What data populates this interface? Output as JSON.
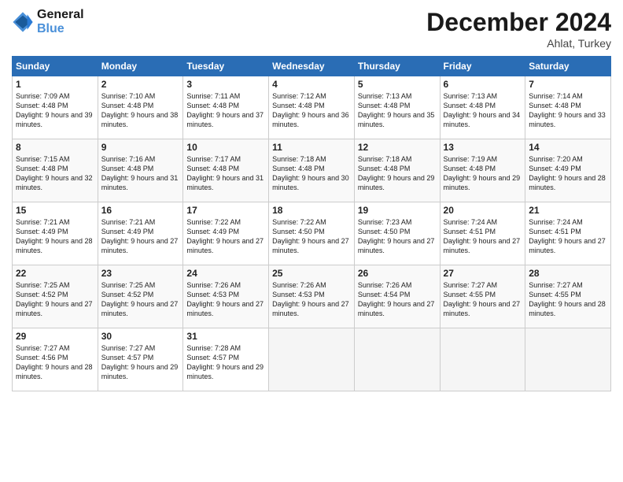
{
  "logo": {
    "line1": "General",
    "line2": "Blue"
  },
  "title": "December 2024",
  "location": "Ahlat, Turkey",
  "days_of_week": [
    "Sunday",
    "Monday",
    "Tuesday",
    "Wednesday",
    "Thursday",
    "Friday",
    "Saturday"
  ],
  "weeks": [
    [
      {
        "day": "1",
        "sunrise": "Sunrise: 7:09 AM",
        "sunset": "Sunset: 4:48 PM",
        "daylight": "Daylight: 9 hours and 39 minutes."
      },
      {
        "day": "2",
        "sunrise": "Sunrise: 7:10 AM",
        "sunset": "Sunset: 4:48 PM",
        "daylight": "Daylight: 9 hours and 38 minutes."
      },
      {
        "day": "3",
        "sunrise": "Sunrise: 7:11 AM",
        "sunset": "Sunset: 4:48 PM",
        "daylight": "Daylight: 9 hours and 37 minutes."
      },
      {
        "day": "4",
        "sunrise": "Sunrise: 7:12 AM",
        "sunset": "Sunset: 4:48 PM",
        "daylight": "Daylight: 9 hours and 36 minutes."
      },
      {
        "day": "5",
        "sunrise": "Sunrise: 7:13 AM",
        "sunset": "Sunset: 4:48 PM",
        "daylight": "Daylight: 9 hours and 35 minutes."
      },
      {
        "day": "6",
        "sunrise": "Sunrise: 7:13 AM",
        "sunset": "Sunset: 4:48 PM",
        "daylight": "Daylight: 9 hours and 34 minutes."
      },
      {
        "day": "7",
        "sunrise": "Sunrise: 7:14 AM",
        "sunset": "Sunset: 4:48 PM",
        "daylight": "Daylight: 9 hours and 33 minutes."
      }
    ],
    [
      {
        "day": "8",
        "sunrise": "Sunrise: 7:15 AM",
        "sunset": "Sunset: 4:48 PM",
        "daylight": "Daylight: 9 hours and 32 minutes."
      },
      {
        "day": "9",
        "sunrise": "Sunrise: 7:16 AM",
        "sunset": "Sunset: 4:48 PM",
        "daylight": "Daylight: 9 hours and 31 minutes."
      },
      {
        "day": "10",
        "sunrise": "Sunrise: 7:17 AM",
        "sunset": "Sunset: 4:48 PM",
        "daylight": "Daylight: 9 hours and 31 minutes."
      },
      {
        "day": "11",
        "sunrise": "Sunrise: 7:18 AM",
        "sunset": "Sunset: 4:48 PM",
        "daylight": "Daylight: 9 hours and 30 minutes."
      },
      {
        "day": "12",
        "sunrise": "Sunrise: 7:18 AM",
        "sunset": "Sunset: 4:48 PM",
        "daylight": "Daylight: 9 hours and 29 minutes."
      },
      {
        "day": "13",
        "sunrise": "Sunrise: 7:19 AM",
        "sunset": "Sunset: 4:48 PM",
        "daylight": "Daylight: 9 hours and 29 minutes."
      },
      {
        "day": "14",
        "sunrise": "Sunrise: 7:20 AM",
        "sunset": "Sunset: 4:49 PM",
        "daylight": "Daylight: 9 hours and 28 minutes."
      }
    ],
    [
      {
        "day": "15",
        "sunrise": "Sunrise: 7:21 AM",
        "sunset": "Sunset: 4:49 PM",
        "daylight": "Daylight: 9 hours and 28 minutes."
      },
      {
        "day": "16",
        "sunrise": "Sunrise: 7:21 AM",
        "sunset": "Sunset: 4:49 PM",
        "daylight": "Daylight: 9 hours and 27 minutes."
      },
      {
        "day": "17",
        "sunrise": "Sunrise: 7:22 AM",
        "sunset": "Sunset: 4:49 PM",
        "daylight": "Daylight: 9 hours and 27 minutes."
      },
      {
        "day": "18",
        "sunrise": "Sunrise: 7:22 AM",
        "sunset": "Sunset: 4:50 PM",
        "daylight": "Daylight: 9 hours and 27 minutes."
      },
      {
        "day": "19",
        "sunrise": "Sunrise: 7:23 AM",
        "sunset": "Sunset: 4:50 PM",
        "daylight": "Daylight: 9 hours and 27 minutes."
      },
      {
        "day": "20",
        "sunrise": "Sunrise: 7:24 AM",
        "sunset": "Sunset: 4:51 PM",
        "daylight": "Daylight: 9 hours and 27 minutes."
      },
      {
        "day": "21",
        "sunrise": "Sunrise: 7:24 AM",
        "sunset": "Sunset: 4:51 PM",
        "daylight": "Daylight: 9 hours and 27 minutes."
      }
    ],
    [
      {
        "day": "22",
        "sunrise": "Sunrise: 7:25 AM",
        "sunset": "Sunset: 4:52 PM",
        "daylight": "Daylight: 9 hours and 27 minutes."
      },
      {
        "day": "23",
        "sunrise": "Sunrise: 7:25 AM",
        "sunset": "Sunset: 4:52 PM",
        "daylight": "Daylight: 9 hours and 27 minutes."
      },
      {
        "day": "24",
        "sunrise": "Sunrise: 7:26 AM",
        "sunset": "Sunset: 4:53 PM",
        "daylight": "Daylight: 9 hours and 27 minutes."
      },
      {
        "day": "25",
        "sunrise": "Sunrise: 7:26 AM",
        "sunset": "Sunset: 4:53 PM",
        "daylight": "Daylight: 9 hours and 27 minutes."
      },
      {
        "day": "26",
        "sunrise": "Sunrise: 7:26 AM",
        "sunset": "Sunset: 4:54 PM",
        "daylight": "Daylight: 9 hours and 27 minutes."
      },
      {
        "day": "27",
        "sunrise": "Sunrise: 7:27 AM",
        "sunset": "Sunset: 4:55 PM",
        "daylight": "Daylight: 9 hours and 27 minutes."
      },
      {
        "day": "28",
        "sunrise": "Sunrise: 7:27 AM",
        "sunset": "Sunset: 4:55 PM",
        "daylight": "Daylight: 9 hours and 28 minutes."
      }
    ],
    [
      {
        "day": "29",
        "sunrise": "Sunrise: 7:27 AM",
        "sunset": "Sunset: 4:56 PM",
        "daylight": "Daylight: 9 hours and 28 minutes."
      },
      {
        "day": "30",
        "sunrise": "Sunrise: 7:27 AM",
        "sunset": "Sunset: 4:57 PM",
        "daylight": "Daylight: 9 hours and 29 minutes."
      },
      {
        "day": "31",
        "sunrise": "Sunrise: 7:28 AM",
        "sunset": "Sunset: 4:57 PM",
        "daylight": "Daylight: 9 hours and 29 minutes."
      },
      null,
      null,
      null,
      null
    ]
  ]
}
